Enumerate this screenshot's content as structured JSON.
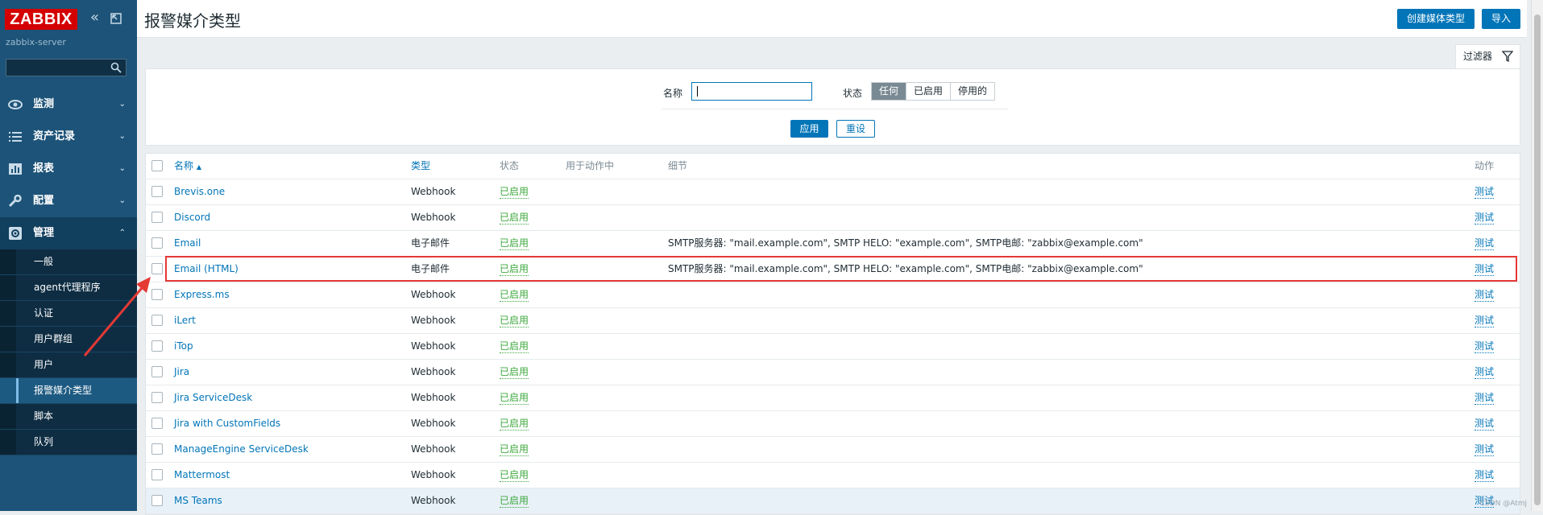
{
  "sidebar": {
    "logo": "ZABBIX",
    "server": "zabbix-server",
    "search_placeholder": "",
    "menu": [
      {
        "label": "监测",
        "icon": "eye-icon"
      },
      {
        "label": "资产记录",
        "icon": "list-icon"
      },
      {
        "label": "报表",
        "icon": "bar-chart-icon"
      },
      {
        "label": "配置",
        "icon": "wrench-icon"
      },
      {
        "label": "管理",
        "icon": "gear-icon"
      }
    ],
    "submenu": [
      "一般",
      "agent代理程序",
      "认证",
      "用户群组",
      "用户",
      "报警媒介类型",
      "脚本",
      "队列"
    ],
    "selected_submenu": "报警媒介类型"
  },
  "header": {
    "title": "报警媒介类型",
    "create_button": "创建媒体类型",
    "import_button": "导入"
  },
  "filter": {
    "tab_label": "过滤器",
    "name_label": "名称",
    "name_value": "",
    "status_label": "状态",
    "status_options": [
      "任何",
      "已启用",
      "停用的"
    ],
    "status_selected": "任何",
    "apply": "应用",
    "reset": "重设"
  },
  "table": {
    "columns": {
      "name": "名称",
      "type": "类型",
      "status": "状态",
      "used_in_actions": "用于动作中",
      "details": "细节",
      "action": "动作"
    },
    "sort_indicator": "▲",
    "rows": [
      {
        "name": "Brevis.one",
        "type": "Webhook",
        "status": "已启用",
        "details": "",
        "action": "测试"
      },
      {
        "name": "Discord",
        "type": "Webhook",
        "status": "已启用",
        "details": "",
        "action": "测试"
      },
      {
        "name": "Email",
        "type": "电子邮件",
        "status": "已启用",
        "details": "SMTP服务器: \"mail.example.com\", SMTP HELO: \"example.com\", SMTP电邮: \"zabbix@example.com\"",
        "action": "测试"
      },
      {
        "name": "Email (HTML)",
        "type": "电子邮件",
        "status": "已启用",
        "details": "SMTP服务器: \"mail.example.com\", SMTP HELO: \"example.com\", SMTP电邮: \"zabbix@example.com\"",
        "action": "测试"
      },
      {
        "name": "Express.ms",
        "type": "Webhook",
        "status": "已启用",
        "details": "",
        "action": "测试"
      },
      {
        "name": "iLert",
        "type": "Webhook",
        "status": "已启用",
        "details": "",
        "action": "测试"
      },
      {
        "name": "iTop",
        "type": "Webhook",
        "status": "已启用",
        "details": "",
        "action": "测试"
      },
      {
        "name": "Jira",
        "type": "Webhook",
        "status": "已启用",
        "details": "",
        "action": "测试"
      },
      {
        "name": "Jira ServiceDesk",
        "type": "Webhook",
        "status": "已启用",
        "details": "",
        "action": "测试"
      },
      {
        "name": "Jira with CustomFields",
        "type": "Webhook",
        "status": "已启用",
        "details": "",
        "action": "测试"
      },
      {
        "name": "ManageEngine ServiceDesk",
        "type": "Webhook",
        "status": "已启用",
        "details": "",
        "action": "测试"
      },
      {
        "name": "Mattermost",
        "type": "Webhook",
        "status": "已启用",
        "details": "",
        "action": "测试"
      },
      {
        "name": "MS Teams",
        "type": "Webhook",
        "status": "已启用",
        "details": "",
        "action": "测试"
      }
    ],
    "highlighted_row": "MS Teams",
    "annotated_row": "Email (HTML)"
  },
  "colors": {
    "sidebar_bg": "#1d5378",
    "accent": "#0275b8",
    "enabled": "#3ea83e",
    "annotation": "#e53935",
    "logo_bg": "#d40000"
  },
  "watermark": "CSDN @Atmj"
}
